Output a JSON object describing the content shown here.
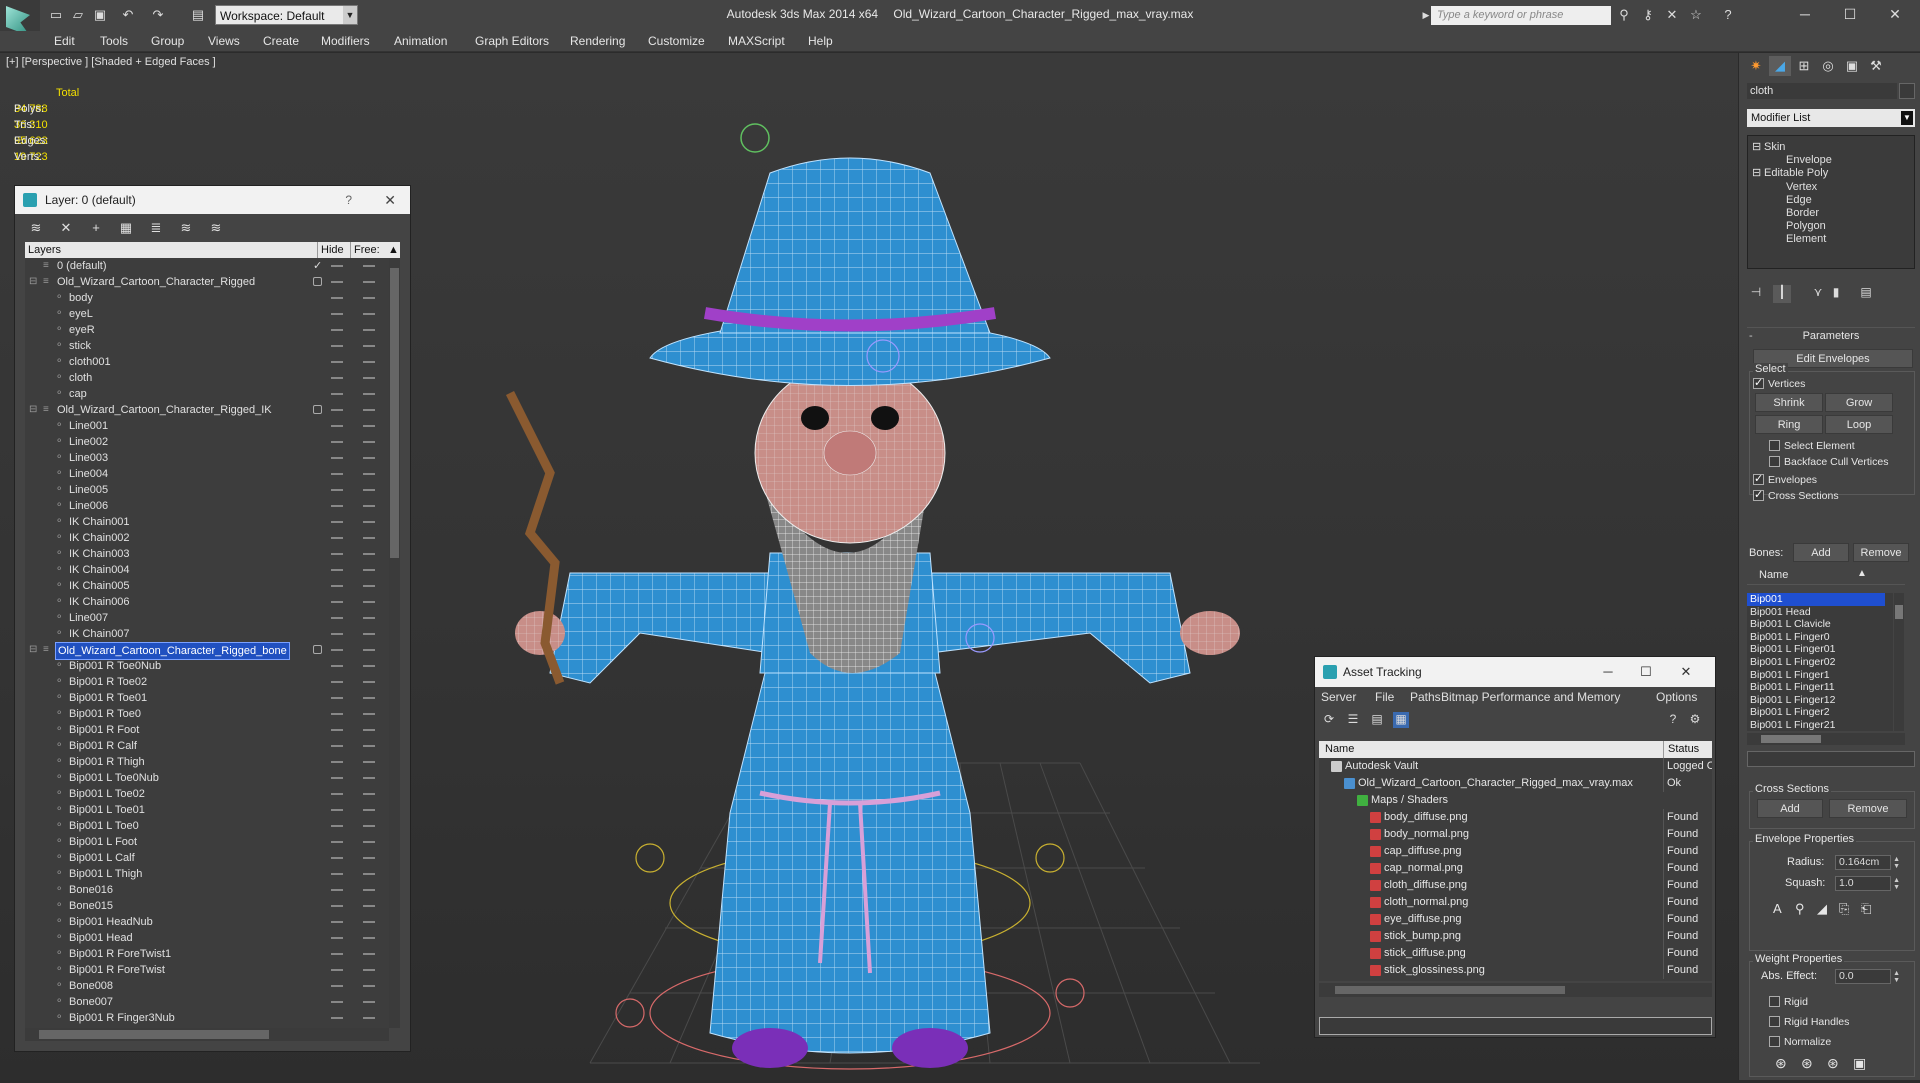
{
  "titlebar": {
    "workspace": "Workspace: Default",
    "app_name": "Autodesk 3ds Max  2014 x64",
    "file_name": "Old_Wizard_Cartoon_Character_Rigged_max_vray.max",
    "search_placeholder": "Type a keyword or phrase"
  },
  "menu": [
    "Edit",
    "Tools",
    "Group",
    "Views",
    "Create",
    "Modifiers",
    "Animation",
    "Graph Editors",
    "Rendering",
    "Customize",
    "MAXScript",
    "Help"
  ],
  "viewport": {
    "label": "[+] [Perspective ] [Shaded + Edged Faces ]",
    "stats": {
      "header": "Total",
      "rows": [
        {
          "label": "Polys:",
          "value": "34 788"
        },
        {
          "label": "Tris:",
          "value": "36 310"
        },
        {
          "label": "Edges:",
          "value": "95 623"
        },
        {
          "label": "Verts:",
          "value": "19 723"
        }
      ]
    }
  },
  "layer_panel": {
    "title": "Layer: 0 (default)",
    "help": "?",
    "columns": {
      "layers": "Layers",
      "hide": "Hide",
      "freeze": "Free:"
    },
    "rows": [
      {
        "name": "0 (default)",
        "level": 0,
        "kind": "layer",
        "check": true
      },
      {
        "name": "Old_Wizard_Cartoon_Character_Rigged",
        "level": 0,
        "kind": "layer-group"
      },
      {
        "name": "body",
        "level": 1,
        "kind": "object"
      },
      {
        "name": "eyeL",
        "level": 1,
        "kind": "object"
      },
      {
        "name": "eyeR",
        "level": 1,
        "kind": "object"
      },
      {
        "name": "stick",
        "level": 1,
        "kind": "object"
      },
      {
        "name": "cloth001",
        "level": 1,
        "kind": "object"
      },
      {
        "name": "cloth",
        "level": 1,
        "kind": "object"
      },
      {
        "name": "cap",
        "level": 1,
        "kind": "object"
      },
      {
        "name": "Old_Wizard_Cartoon_Character_Rigged_IK",
        "level": 0,
        "kind": "layer-group"
      },
      {
        "name": "Line001",
        "level": 1,
        "kind": "object"
      },
      {
        "name": "Line002",
        "level": 1,
        "kind": "object"
      },
      {
        "name": "Line003",
        "level": 1,
        "kind": "object"
      },
      {
        "name": "Line004",
        "level": 1,
        "kind": "object"
      },
      {
        "name": "Line005",
        "level": 1,
        "kind": "object"
      },
      {
        "name": "Line006",
        "level": 1,
        "kind": "object"
      },
      {
        "name": "IK Chain001",
        "level": 1,
        "kind": "object"
      },
      {
        "name": "IK Chain002",
        "level": 1,
        "kind": "object"
      },
      {
        "name": "IK Chain003",
        "level": 1,
        "kind": "object"
      },
      {
        "name": "IK Chain004",
        "level": 1,
        "kind": "object"
      },
      {
        "name": "IK Chain005",
        "level": 1,
        "kind": "object"
      },
      {
        "name": "IK Chain006",
        "level": 1,
        "kind": "object"
      },
      {
        "name": "Line007",
        "level": 1,
        "kind": "object"
      },
      {
        "name": "IK Chain007",
        "level": 1,
        "kind": "object"
      },
      {
        "name": "Old_Wizard_Cartoon_Character_Rigged_bone",
        "level": 0,
        "kind": "layer-group",
        "selected": true
      },
      {
        "name": "Bip001 R Toe0Nub",
        "level": 1,
        "kind": "object"
      },
      {
        "name": "Bip001 R Toe02",
        "level": 1,
        "kind": "object"
      },
      {
        "name": "Bip001 R Toe01",
        "level": 1,
        "kind": "object"
      },
      {
        "name": "Bip001 R Toe0",
        "level": 1,
        "kind": "object"
      },
      {
        "name": "Bip001 R Foot",
        "level": 1,
        "kind": "object"
      },
      {
        "name": "Bip001 R Calf",
        "level": 1,
        "kind": "object"
      },
      {
        "name": "Bip001 R Thigh",
        "level": 1,
        "kind": "object"
      },
      {
        "name": "Bip001 L Toe0Nub",
        "level": 1,
        "kind": "object"
      },
      {
        "name": "Bip001 L Toe02",
        "level": 1,
        "kind": "object"
      },
      {
        "name": "Bip001 L Toe01",
        "level": 1,
        "kind": "object"
      },
      {
        "name": "Bip001 L Toe0",
        "level": 1,
        "kind": "object"
      },
      {
        "name": "Bip001 L Foot",
        "level": 1,
        "kind": "object"
      },
      {
        "name": "Bip001 L Calf",
        "level": 1,
        "kind": "object"
      },
      {
        "name": "Bip001 L Thigh",
        "level": 1,
        "kind": "object"
      },
      {
        "name": "Bone016",
        "level": 1,
        "kind": "object"
      },
      {
        "name": "Bone015",
        "level": 1,
        "kind": "object"
      },
      {
        "name": "Bip001 HeadNub",
        "level": 1,
        "kind": "object"
      },
      {
        "name": "Bip001 Head",
        "level": 1,
        "kind": "object"
      },
      {
        "name": "Bip001 R ForeTwist1",
        "level": 1,
        "kind": "object"
      },
      {
        "name": "Bip001 R ForeTwist",
        "level": 1,
        "kind": "object"
      },
      {
        "name": "Bone008",
        "level": 1,
        "kind": "object"
      },
      {
        "name": "Bone007",
        "level": 1,
        "kind": "object"
      },
      {
        "name": "Bip001 R Finger3Nub",
        "level": 1,
        "kind": "object"
      }
    ]
  },
  "asset_tracking": {
    "title": "Asset Tracking",
    "menu": [
      "Server",
      "File",
      "Paths",
      "Bitmap Performance and Memory",
      "Options"
    ],
    "columns": {
      "name": "Name",
      "status": "Status"
    },
    "rows": [
      {
        "name": "Autodesk Vault",
        "status": "Logged O",
        "level": 0,
        "icon": "vault-icon"
      },
      {
        "name": "Old_Wizard_Cartoon_Character_Rigged_max_vray.max",
        "status": "Ok",
        "level": 1,
        "icon": "max-file-icon"
      },
      {
        "name": "Maps / Shaders",
        "status": "",
        "level": 2,
        "icon": "maps-icon"
      },
      {
        "name": "body_diffuse.png",
        "status": "Found",
        "level": 3,
        "icon": "png-icon"
      },
      {
        "name": "body_normal.png",
        "status": "Found",
        "level": 3,
        "icon": "png-icon"
      },
      {
        "name": "cap_diffuse.png",
        "status": "Found",
        "level": 3,
        "icon": "png-icon"
      },
      {
        "name": "cap_normal.png",
        "status": "Found",
        "level": 3,
        "icon": "png-icon"
      },
      {
        "name": "cloth_diffuse.png",
        "status": "Found",
        "level": 3,
        "icon": "png-icon"
      },
      {
        "name": "cloth_normal.png",
        "status": "Found",
        "level": 3,
        "icon": "png-icon"
      },
      {
        "name": "eye_diffuse.png",
        "status": "Found",
        "level": 3,
        "icon": "png-icon"
      },
      {
        "name": "stick_bump.png",
        "status": "Found",
        "level": 3,
        "icon": "png-icon"
      },
      {
        "name": "stick_diffuse.png",
        "status": "Found",
        "level": 3,
        "icon": "png-icon"
      },
      {
        "name": "stick_glossiness.png",
        "status": "Found",
        "level": 3,
        "icon": "png-icon"
      }
    ]
  },
  "command_panel": {
    "object_name": "cloth",
    "modifier_list": "Modifier List",
    "stack": [
      {
        "label": "Skin",
        "level": 0
      },
      {
        "label": "Envelope",
        "level": 1
      },
      {
        "label": "Editable Poly",
        "level": 0
      },
      {
        "label": "Vertex",
        "level": 1
      },
      {
        "label": "Edge",
        "level": 1
      },
      {
        "label": "Border",
        "level": 1
      },
      {
        "label": "Polygon",
        "level": 1
      },
      {
        "label": "Element",
        "level": 1
      }
    ],
    "parameters": {
      "title": "Parameters",
      "collapse": "-",
      "edit_envelopes": "Edit Envelopes",
      "select_group": "Select",
      "vertices": "Vertices",
      "shrink": "Shrink",
      "grow": "Grow",
      "ring": "Ring",
      "loop": "Loop",
      "select_element": "Select Element",
      "backface_cull": "Backface Cull Vertices",
      "envelopes": "Envelopes",
      "cross_sections": "Cross Sections",
      "bones_label": "Bones:",
      "add": "Add",
      "remove": "Remove",
      "name_col": "Name",
      "bones": [
        "Bip001",
        "Bip001 Head",
        "Bip001 L Clavicle",
        "Bip001 L Finger0",
        "Bip001 L Finger01",
        "Bip001 L Finger02",
        "Bip001 L Finger1",
        "Bip001 L Finger11",
        "Bip001 L Finger12",
        "Bip001 L Finger2",
        "Bip001 L Finger21"
      ],
      "cross_sections_group": "Cross Sections",
      "cs_add": "Add",
      "cs_remove": "Remove",
      "env_props_group": "Envelope Properties",
      "radius_label": "Radius:",
      "radius_value": "0.164cm",
      "squash_label": "Squash:",
      "squash_value": "1.0",
      "weight_props_group": "Weight Properties",
      "abs_effect_label": "Abs. Effect:",
      "abs_effect_value": "0.0",
      "rigid": "Rigid",
      "rigid_handles": "Rigid Handles",
      "normalize": "Normalize"
    }
  }
}
